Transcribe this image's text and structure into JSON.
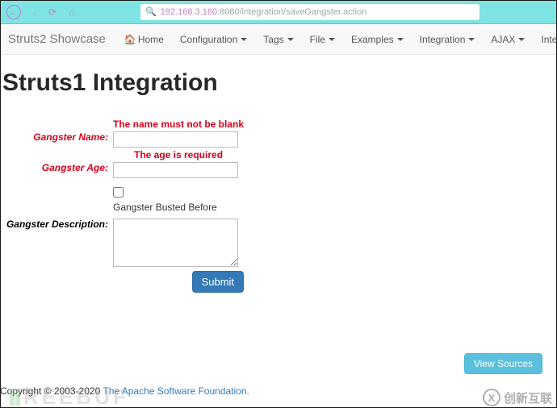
{
  "browser": {
    "url_ip": "192.168.3.160",
    "url_port": ":8080",
    "url_path": "/integration/saveGangster.action"
  },
  "navbar": {
    "brand": "Struts2 Showcase",
    "items": [
      {
        "label": "Home",
        "icon": "home",
        "dropdown": false
      },
      {
        "label": "Configuration",
        "dropdown": true
      },
      {
        "label": "Tags",
        "dropdown": true
      },
      {
        "label": "File",
        "dropdown": true
      },
      {
        "label": "Examples",
        "dropdown": true
      },
      {
        "label": "Integration",
        "dropdown": true
      },
      {
        "label": "AJAX",
        "dropdown": true
      },
      {
        "label": "Interactive Demo",
        "dropdown": false
      }
    ]
  },
  "page": {
    "heading": "Struts1 Integration",
    "errors": {
      "name": "The name must not be blank",
      "age": "The age is required"
    },
    "labels": {
      "name": "Gangster Name:",
      "age": "Gangster Age:",
      "busted": "Gangster Busted Before",
      "description": "Gangster Description:"
    },
    "values": {
      "name": "",
      "age": "",
      "busted": false,
      "description": ""
    },
    "submit": "Submit",
    "view_sources": "View Sources"
  },
  "footer": {
    "copyright": "Copyright © 2003-2020 ",
    "link_text": "The Apache Software Foundation.",
    "link_trail": ""
  },
  "watermarks": {
    "left": "REEBUF",
    "right": "创新互联"
  }
}
